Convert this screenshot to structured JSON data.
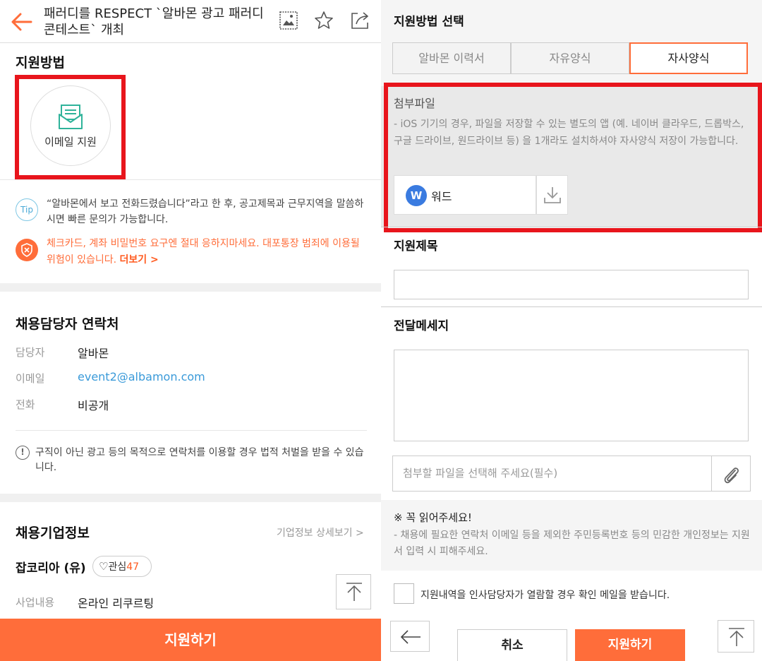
{
  "colors": {
    "accent": "#ff6d3a",
    "highlight": "#e8151c",
    "link": "#3a9ad9",
    "word": "#3a7be0"
  },
  "left": {
    "header": {
      "title": "패러디를 RESPECT `알바몬 광고 패러디 콘테스트` 개최",
      "icons": [
        "back-arrow-icon",
        "image-icon",
        "star-icon",
        "share-icon"
      ]
    },
    "apply_method": {
      "title": "지원방법",
      "email_label": "이메일 지원"
    },
    "tip": {
      "badge": "Tip",
      "text": "“알바몬에서 보고 전화드렸습니다”라고 한 후, 공고제목과 근무지역을 말씀하시면 빠른 문의가 가능합니다."
    },
    "warning": {
      "text": "체크카드, 계좌 비밀번호 요구엔 절대 응하지마세요. 대포통장 범죄에 이용될 위험이 있습니다.",
      "more": "더보기 >"
    },
    "contact": {
      "title": "채용담당자 연락처",
      "manager_label": "담당자",
      "manager_value": "알바몬",
      "email_label": "이메일",
      "email_value": "event2@albamon.com",
      "phone_label": "전화",
      "phone_value": "비공개",
      "notice": "구직이 아닌 광고 등의 목적으로 연락처를 이용할 경우 법적 처벌을 받을 수 있습니다."
    },
    "company": {
      "title": "채용기업정보",
      "detail_link": "기업정보 상세보기 >",
      "name": "잡코리아 (유)",
      "fav_label": "관심",
      "fav_count": "47",
      "business_label": "사업내용",
      "business_value": "온라인 리쿠르팅"
    },
    "apply_button": "지원하기"
  },
  "right": {
    "method_title": "지원방법 선택",
    "tabs": [
      {
        "label": "알바몬 이력서",
        "active": false
      },
      {
        "label": "자유양식",
        "active": false
      },
      {
        "label": "자사양식",
        "active": true
      }
    ],
    "attach": {
      "title": "첨부파일",
      "desc": "- iOS 기기의 경우, 파일을 저장할 수 있는 별도의 앱 (예. 네이버 클라우드, 드롭박스, 구글 드라이브, 원드라이브 등) 을 1개라도 설치하셔야 자사양식 저장이 가능합니다.",
      "file_icon_letter": "W",
      "file_name": "워드"
    },
    "subject": {
      "title": "지원제목",
      "value": ""
    },
    "message": {
      "title": "전달메세지",
      "value": ""
    },
    "attach_field": {
      "placeholder": "첨부할 파일을 선택해 주세요(필수)"
    },
    "must_read": {
      "title": "※ 꼭 읽어주세요!",
      "text": "- 채용에 필요한 연락처 이메일 등을 제외한 주민등록번호 등의 민감한 개인정보는 지원서 입력 시 피해주세요."
    },
    "checkbox_label": "지원내역을 인사담당자가 열람할 경우 확인 메일을 받습니다.",
    "checkbox_checked": false,
    "cancel_button": "취소",
    "apply_button": "지원하기"
  }
}
